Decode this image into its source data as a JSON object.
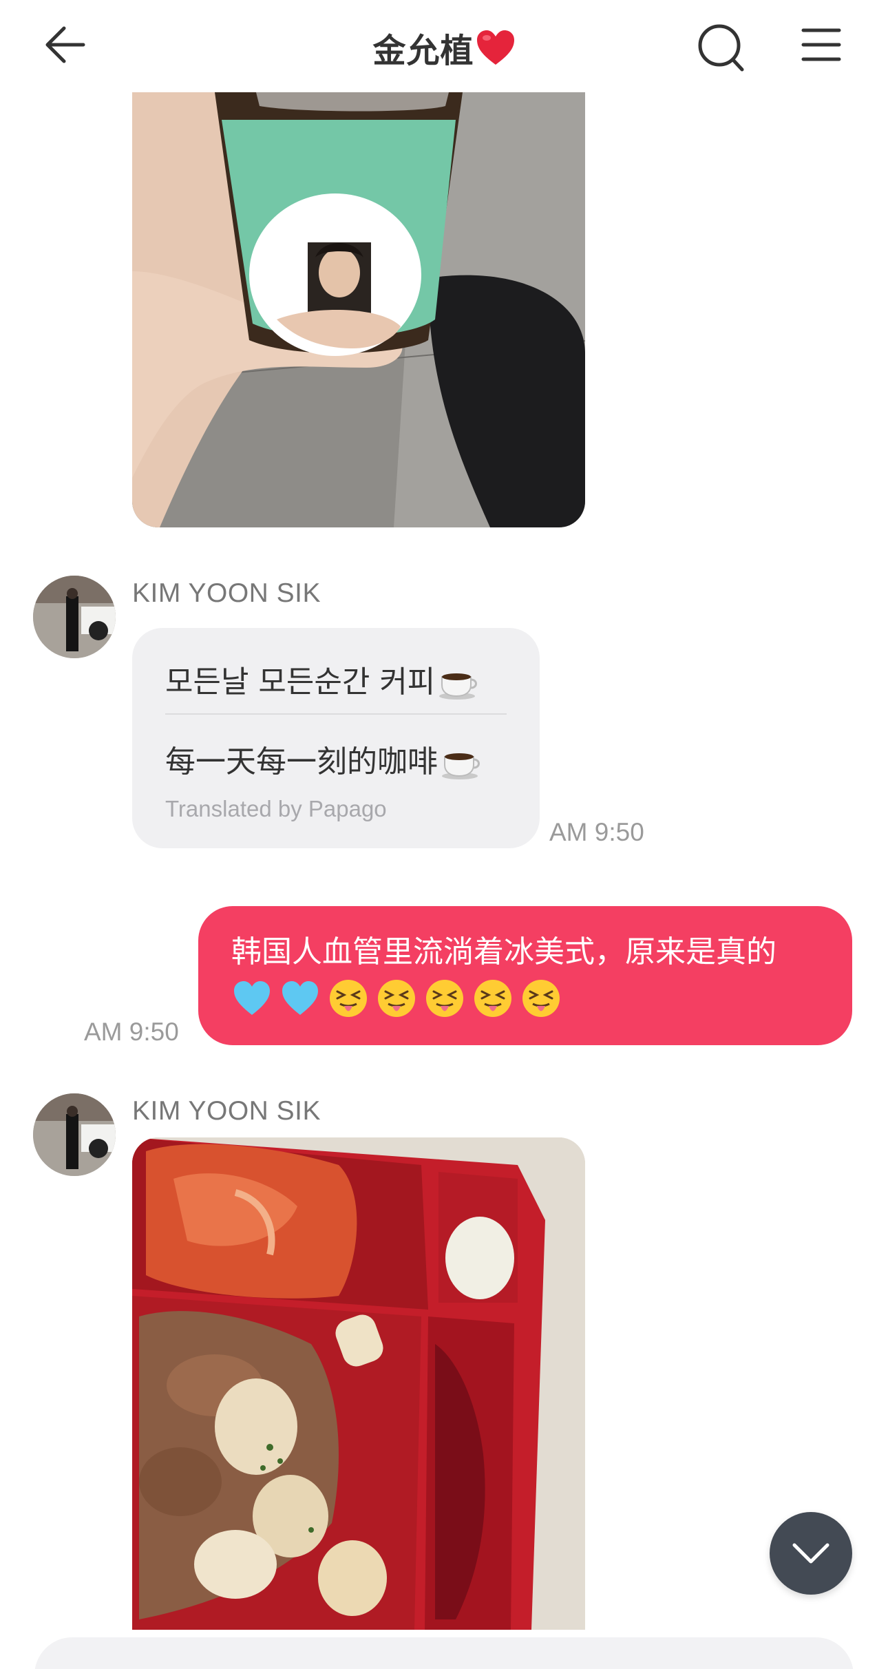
{
  "header": {
    "title": "金允植",
    "title_emoji": "red-heart-icon",
    "back_icon": "back-arrow-icon",
    "search_icon": "search-icon",
    "menu_icon": "hamburger-menu-icon"
  },
  "messages": {
    "coffee_photo": {
      "type": "image",
      "depicts": "coffee-cup-photo"
    },
    "translated": {
      "sender": "KIM YOON SIK",
      "original": "모든날 모든순간 커피",
      "translation": "每一天每一刻的咖啡",
      "credit": "Translated by Papago",
      "time": "AM 9:50",
      "emoji": "hot-beverage-icon"
    },
    "outgoing": {
      "text": "韩国人血管里流淌着冰美式，原来是真的",
      "emojis": [
        "light-blue-heart-icon",
        "light-blue-heart-icon",
        "squinting-tongue-face-icon",
        "squinting-tongue-face-icon",
        "squinting-tongue-face-icon",
        "squinting-tongue-face-icon",
        "squinting-tongue-face-icon"
      ],
      "time": "AM 9:50"
    },
    "food_photo": {
      "sender": "KIM YOON SIK",
      "type": "image",
      "depicts": "lunch-box-photo"
    }
  },
  "colors": {
    "outgoing_bubble": "#f43f62",
    "incoming_bubble": "#f0f0f2",
    "fab": "#434a54"
  }
}
